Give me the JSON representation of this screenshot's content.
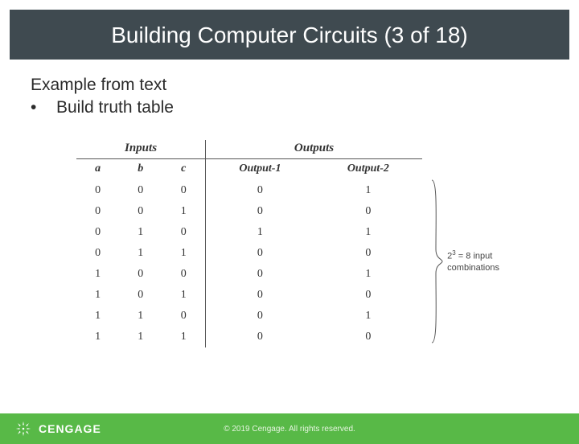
{
  "title": "Building Computer Circuits (3 of 18)",
  "intro": "Example from text",
  "bullet": "Build truth table",
  "table": {
    "section_inputs": "Inputs",
    "section_outputs": "Outputs",
    "cols": {
      "a": "a",
      "b": "b",
      "c": "c",
      "o1": "Output-1",
      "o2": "Output-2"
    },
    "rows": [
      {
        "a": "0",
        "b": "0",
        "c": "0",
        "o1": "0",
        "o2": "1"
      },
      {
        "a": "0",
        "b": "0",
        "c": "1",
        "o1": "0",
        "o2": "0"
      },
      {
        "a": "0",
        "b": "1",
        "c": "0",
        "o1": "1",
        "o2": "1"
      },
      {
        "a": "0",
        "b": "1",
        "c": "1",
        "o1": "0",
        "o2": "0"
      },
      {
        "a": "1",
        "b": "0",
        "c": "0",
        "o1": "0",
        "o2": "1"
      },
      {
        "a": "1",
        "b": "0",
        "c": "1",
        "o1": "0",
        "o2": "0"
      },
      {
        "a": "1",
        "b": "1",
        "c": "0",
        "o1": "0",
        "o2": "1"
      },
      {
        "a": "1",
        "b": "1",
        "c": "1",
        "o1": "0",
        "o2": "0"
      }
    ]
  },
  "annotation": {
    "formula_html": "2<sup>3</sup> = 8 input<br>combinations"
  },
  "footer": {
    "brand": "CENGAGE",
    "copyright": "© 2019 Cengage. All rights reserved."
  }
}
